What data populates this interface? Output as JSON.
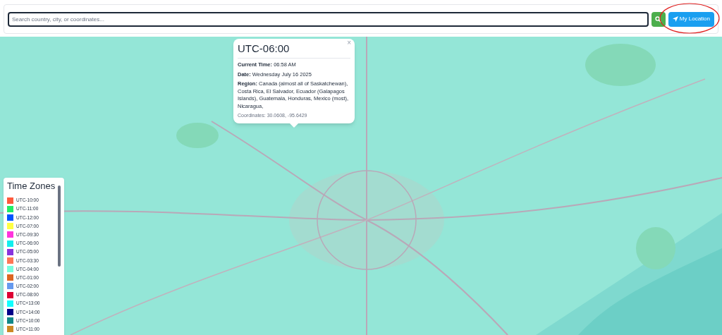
{
  "search": {
    "placeholder": "Search country, city, or coordinates..."
  },
  "buttons": {
    "location": "My Location"
  },
  "popup": {
    "title": "UTC-06:00",
    "close": "×",
    "fields": [
      {
        "label": "Current Time:",
        "value": "06:58 AM"
      },
      {
        "label": "Date:",
        "value": "Wednesday July 16 2025"
      },
      {
        "label": "Region:",
        "value": "Canada (almost all of Saskatchewan), Costa Rica, El Salvador, Ecuador (Galapagos Islands), Guatemala, Honduras, Mexico (most), Nicaragua,"
      }
    ],
    "coordinates": "Coordinates: 30.0608, -95.6429"
  },
  "legend": {
    "title": "Time Zones",
    "items": [
      {
        "label": "UTC-10:00",
        "color": "#ff5a3c"
      },
      {
        "label": "UTC-11:00",
        "color": "#22ee66"
      },
      {
        "label": "UTC-12:00",
        "color": "#0055ff"
      },
      {
        "label": "UTC-07:00",
        "color": "#ffff44"
      },
      {
        "label": "UTC-09:30",
        "color": "#ff33dd"
      },
      {
        "label": "UTC-06:00",
        "color": "#11eeee"
      },
      {
        "label": "UTC-05:00",
        "color": "#8833dd"
      },
      {
        "label": "UTC-03:30",
        "color": "#ff7755"
      },
      {
        "label": "UTC-04:00",
        "color": "#77ffdd"
      },
      {
        "label": "UTC-01:00",
        "color": "#dd6622"
      },
      {
        "label": "UTC-02:00",
        "color": "#6699ee"
      },
      {
        "label": "UTC-08:00",
        "color": "#dd0033"
      },
      {
        "label": "UTC+13:00",
        "color": "#11ffff"
      },
      {
        "label": "UTC+14:00",
        "color": "#000088"
      },
      {
        "label": "UTC+10:00",
        "color": "#118888"
      },
      {
        "label": "UTC+11:00",
        "color": "#cc8822"
      }
    ]
  }
}
